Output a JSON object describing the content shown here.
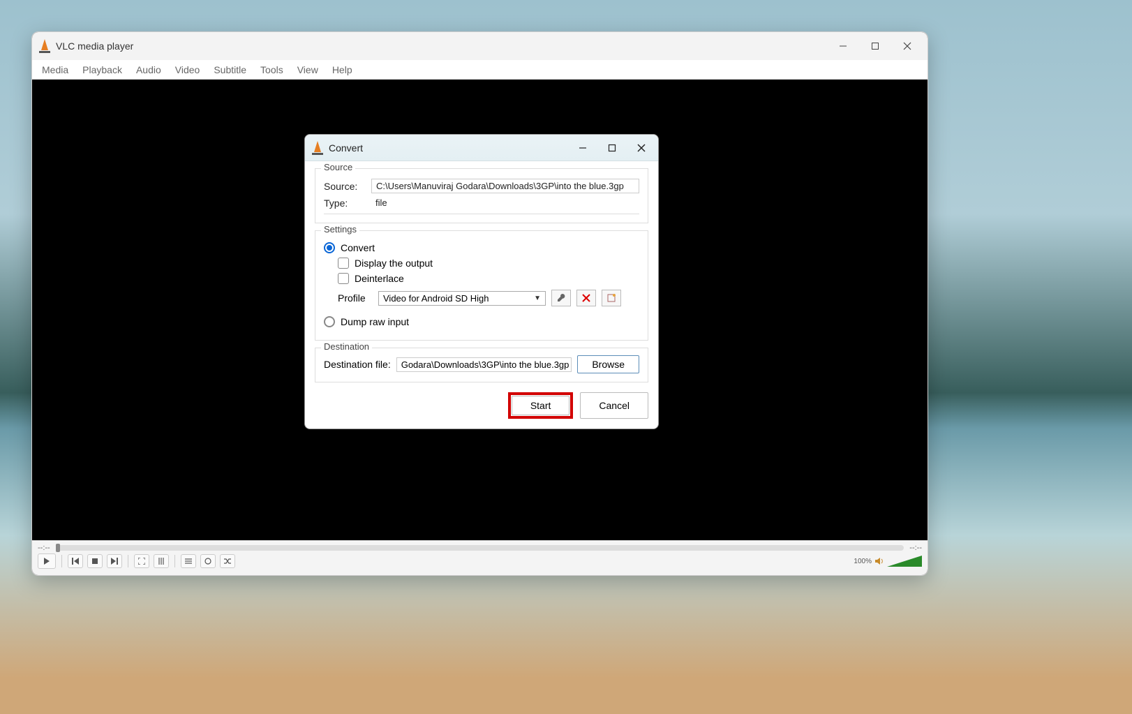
{
  "main_window": {
    "title": "VLC media player",
    "menu": [
      "Media",
      "Playback",
      "Audio",
      "Video",
      "Subtitle",
      "Tools",
      "View",
      "Help"
    ],
    "time_left": "--:--",
    "time_right": "--:--",
    "volume_label": "100%"
  },
  "dialog": {
    "title": "Convert",
    "source_section": {
      "legend": "Source",
      "source_label": "Source:",
      "source_value": "C:\\Users\\Manuviraj Godara\\Downloads\\3GP\\into the blue.3gp",
      "type_label": "Type:",
      "type_value": "file"
    },
    "settings_section": {
      "legend": "Settings",
      "convert_label": "Convert",
      "display_output_label": "Display the output",
      "deinterlace_label": "Deinterlace",
      "profile_label": "Profile",
      "profile_value": "Video for Android SD High",
      "dump_label": "Dump raw input"
    },
    "destination_section": {
      "legend": "Destination",
      "dest_label": "Destination file:",
      "dest_value": "Godara\\Downloads\\3GP\\into the blue.3gp",
      "browse_label": "Browse"
    },
    "start_label": "Start",
    "cancel_label": "Cancel"
  }
}
